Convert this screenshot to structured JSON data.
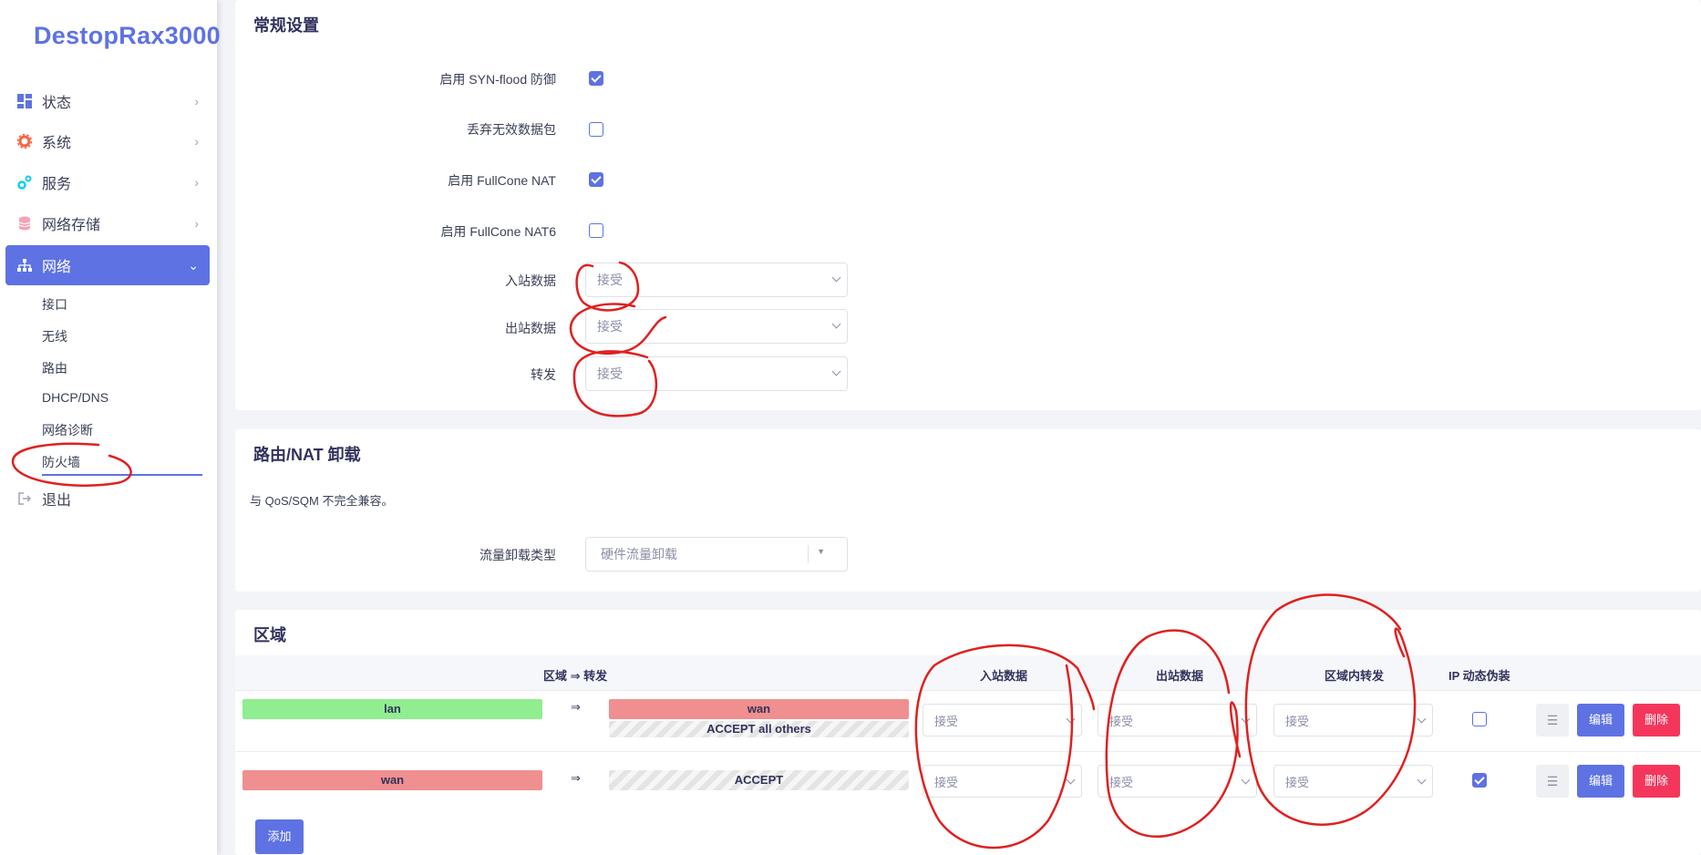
{
  "brand": "DestopRax3000",
  "sidebar": {
    "items": [
      {
        "label": "状态",
        "icon": "dashboard-icon"
      },
      {
        "label": "系统",
        "icon": "gear-icon"
      },
      {
        "label": "服务",
        "icon": "cogs-icon"
      },
      {
        "label": "网络存储",
        "icon": "database-icon"
      },
      {
        "label": "网络",
        "icon": "sitemap-icon"
      }
    ],
    "submenu": [
      "接口",
      "无线",
      "路由",
      "DHCP/DNS",
      "网络诊断",
      "防火墙"
    ],
    "logout": "退出"
  },
  "general": {
    "title": "常规设置",
    "syn_flood_label": "启用 SYN-flood 防御",
    "syn_flood_checked": true,
    "drop_invalid_label": "丢弃无效数据包",
    "drop_invalid_checked": false,
    "fullcone_label": "启用 FullCone NAT",
    "fullcone_checked": true,
    "fullcone6_label": "启用 FullCone NAT6",
    "fullcone6_checked": false,
    "input_label": "入站数据",
    "input_value": "接受",
    "output_label": "出站数据",
    "output_value": "接受",
    "forward_label": "转发",
    "forward_value": "接受"
  },
  "offload": {
    "title": "路由/NAT 卸载",
    "note": "与 QoS/SQM 不完全兼容。",
    "type_label": "流量卸载类型",
    "type_value": "硬件流量卸载"
  },
  "zones": {
    "title": "区域",
    "headers": {
      "zone_forward": "区域 ⇒ 转发",
      "input": "入站数据",
      "output": "出站数据",
      "intra": "区域内转发",
      "masq": "IP 动态伪装"
    },
    "rows": [
      {
        "zone": "lan",
        "arrow": "⇒",
        "dest": "wan",
        "dest_extra": "ACCEPT all others",
        "input": "接受",
        "output": "接受",
        "intra": "接受",
        "masq": false,
        "edit": "编辑",
        "delete": "删除",
        "sort": "☰"
      },
      {
        "zone": "wan",
        "arrow": "⇒",
        "dest": "ACCEPT",
        "dest_extra": "",
        "input": "接受",
        "output": "接受",
        "intra": "接受",
        "masq": true,
        "edit": "编辑",
        "delete": "删除",
        "sort": "☰"
      }
    ],
    "add_label": "添加"
  },
  "colors": {
    "accent": "#5e72e4",
    "danger": "#f5365c",
    "zone_lan": "#90ee90",
    "zone_wan": "#f08f8f",
    "annotation": "#e02020"
  }
}
